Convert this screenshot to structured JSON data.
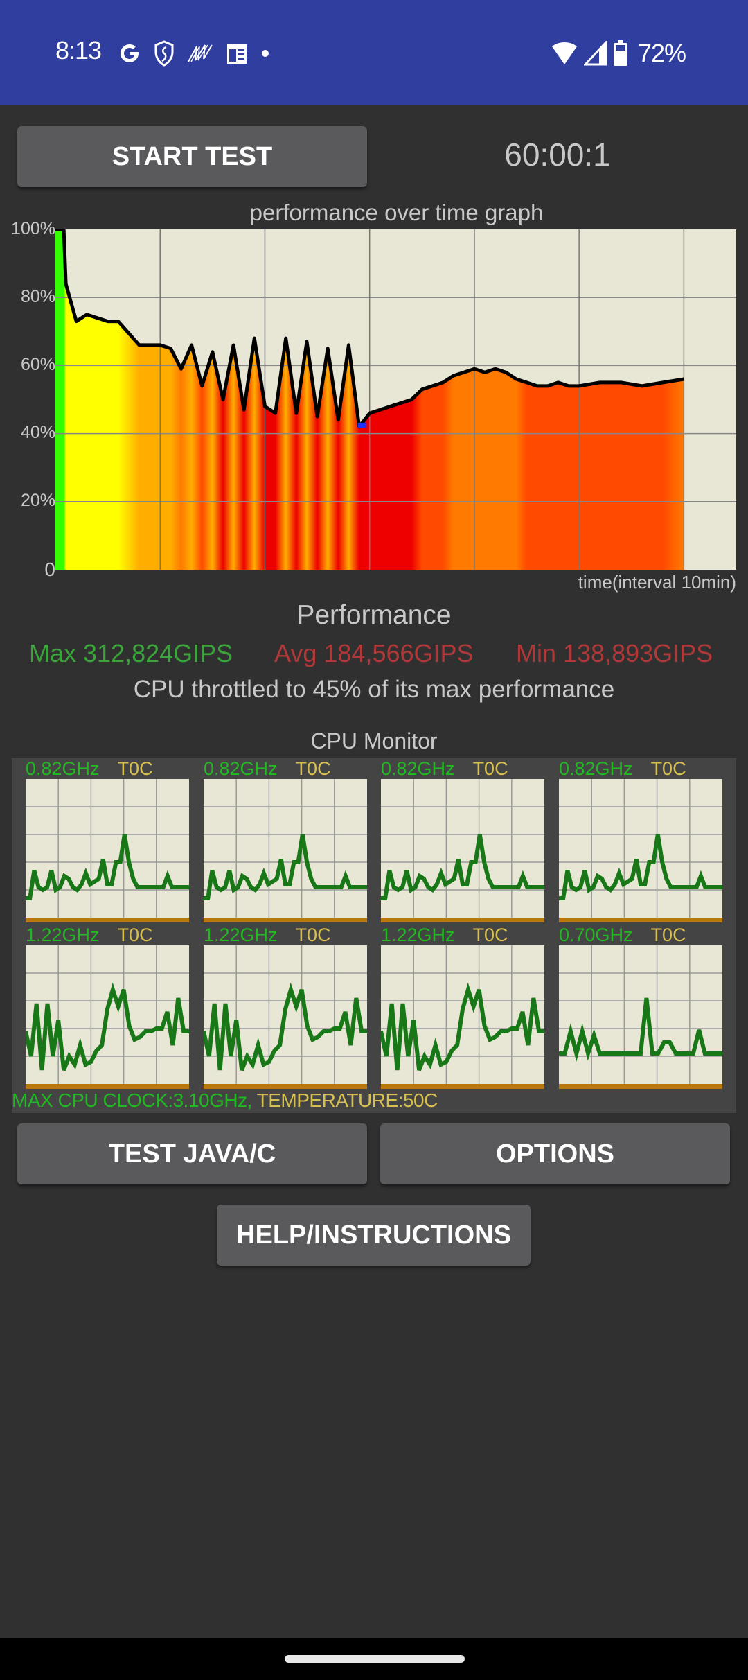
{
  "status_bar": {
    "time": "8:13",
    "left_icons": [
      "google-icon",
      "shield-icon",
      "activity-icon",
      "calendar-icon",
      "dot-icon"
    ],
    "right_icons": [
      "wifi-icon",
      "signal-icon",
      "battery-icon"
    ],
    "battery_percent": "72%"
  },
  "toolbar": {
    "start_label": "START TEST",
    "timer": "60:00:1"
  },
  "performance_graph": {
    "title": "performance over time graph",
    "x_label": "time(interval 10min)",
    "y_ticks": [
      "100%",
      "80%",
      "60%",
      "40%",
      "20%",
      "0"
    ]
  },
  "performance": {
    "heading": "Performance",
    "max": "Max 312,824GIPS",
    "avg": "Avg 184,566GIPS",
    "min": "Min 138,893GIPS",
    "throttle_text": "CPU throttled to 45% of its max performance",
    "colors": {
      "max": "#3aa63a",
      "avg": "#b03838",
      "min": "#b03838"
    }
  },
  "cpu_monitor": {
    "title": "CPU Monitor",
    "cores": [
      {
        "freq": "0.82GHz",
        "temp": "T0C",
        "load": [
          14,
          14,
          34,
          22,
          20,
          22,
          34,
          20,
          22,
          30,
          28,
          22,
          20,
          24,
          32,
          24,
          26,
          28,
          42,
          24,
          24,
          40,
          40,
          60,
          40,
          28,
          22,
          22,
          22,
          22,
          22,
          22,
          22,
          30,
          22,
          22,
          22,
          22,
          22
        ]
      },
      {
        "freq": "0.82GHz",
        "temp": "T0C",
        "load": [
          14,
          14,
          34,
          22,
          20,
          22,
          34,
          20,
          22,
          30,
          28,
          22,
          20,
          24,
          32,
          24,
          26,
          28,
          42,
          24,
          24,
          40,
          40,
          60,
          40,
          28,
          22,
          22,
          22,
          22,
          22,
          22,
          22,
          30,
          22,
          22,
          22,
          22,
          22
        ]
      },
      {
        "freq": "0.82GHz",
        "temp": "T0C",
        "load": [
          14,
          14,
          34,
          22,
          20,
          22,
          34,
          20,
          22,
          30,
          28,
          22,
          20,
          24,
          32,
          24,
          26,
          28,
          42,
          24,
          24,
          40,
          40,
          60,
          40,
          28,
          22,
          22,
          22,
          22,
          22,
          22,
          22,
          30,
          22,
          22,
          22,
          22,
          22
        ]
      },
      {
        "freq": "0.82GHz",
        "temp": "T0C",
        "load": [
          14,
          14,
          34,
          22,
          20,
          22,
          34,
          20,
          22,
          30,
          28,
          22,
          20,
          24,
          32,
          24,
          26,
          28,
          42,
          24,
          24,
          40,
          40,
          60,
          40,
          28,
          22,
          22,
          22,
          22,
          22,
          22,
          22,
          30,
          22,
          22,
          22,
          22,
          22
        ]
      },
      {
        "freq": "1.22GHz",
        "temp": "T0C",
        "load": [
          38,
          20,
          58,
          10,
          58,
          20,
          46,
          10,
          20,
          14,
          28,
          14,
          16,
          24,
          28,
          54,
          68,
          56,
          68,
          42,
          32,
          34,
          38,
          38,
          40,
          40,
          52,
          28,
          62,
          38,
          38
        ]
      },
      {
        "freq": "1.22GHz",
        "temp": "T0C",
        "load": [
          38,
          20,
          58,
          10,
          58,
          20,
          46,
          10,
          20,
          14,
          28,
          14,
          16,
          24,
          28,
          54,
          68,
          56,
          68,
          42,
          32,
          34,
          38,
          38,
          40,
          40,
          52,
          28,
          62,
          38,
          38
        ]
      },
      {
        "freq": "1.22GHz",
        "temp": "T0C",
        "load": [
          38,
          20,
          58,
          10,
          58,
          20,
          46,
          10,
          20,
          14,
          28,
          14,
          16,
          24,
          28,
          54,
          68,
          56,
          68,
          42,
          32,
          34,
          38,
          38,
          40,
          40,
          52,
          28,
          62,
          38,
          38
        ]
      },
      {
        "freq": "0.70GHz",
        "temp": "T0C",
        "load": [
          22,
          22,
          38,
          22,
          38,
          22,
          35,
          22,
          22,
          22,
          22,
          22,
          22,
          22,
          22,
          62,
          22,
          22,
          30,
          30,
          22,
          22,
          22,
          22,
          39,
          22,
          22,
          22,
          22
        ]
      }
    ],
    "footer_clock": "MAX CPU CLOCK:3.10GHz,",
    "footer_temp": "TEMPERATURE:50C"
  },
  "buttons": {
    "test_java_c": "TEST JAVA/C",
    "options": "OPTIONS",
    "help": "HELP/INSTRUCTIONS"
  },
  "chart_data": {
    "type": "area",
    "title": "performance over time graph",
    "xlabel": "time(interval 10min)",
    "ylabel": "",
    "ylim": [
      0,
      100
    ],
    "xlim_minutes": [
      0,
      65
    ],
    "y_tick_labels": [
      "0",
      "20%",
      "40%",
      "60%",
      "80%",
      "100%"
    ],
    "grid": true,
    "x_minutes": [
      0,
      0.8,
      1,
      2,
      3,
      4,
      5,
      6,
      8,
      10,
      11,
      12,
      13,
      14,
      15,
      16,
      17,
      18,
      19,
      20,
      21,
      22,
      23,
      24,
      25,
      26,
      27,
      28,
      29,
      30,
      31,
      32,
      33,
      34,
      35,
      36,
      37,
      38,
      39,
      40,
      41,
      42,
      43,
      44,
      45,
      46,
      47,
      48,
      49,
      50,
      52,
      54,
      56,
      58,
      60
    ],
    "series": [
      {
        "name": "performance %",
        "values": [
          100,
          100,
          84,
          73,
          75,
          74,
          73,
          73,
          66,
          66,
          65,
          59,
          66,
          54,
          64,
          50,
          66,
          47,
          68,
          48,
          46,
          68,
          46,
          67,
          45,
          65,
          44,
          66,
          42,
          46,
          47,
          48,
          49,
          50,
          53,
          54,
          55,
          57,
          58,
          59,
          58,
          59,
          58,
          56,
          55,
          54,
          54,
          55,
          54,
          54,
          55,
          55,
          54,
          55,
          56
        ]
      }
    ]
  }
}
